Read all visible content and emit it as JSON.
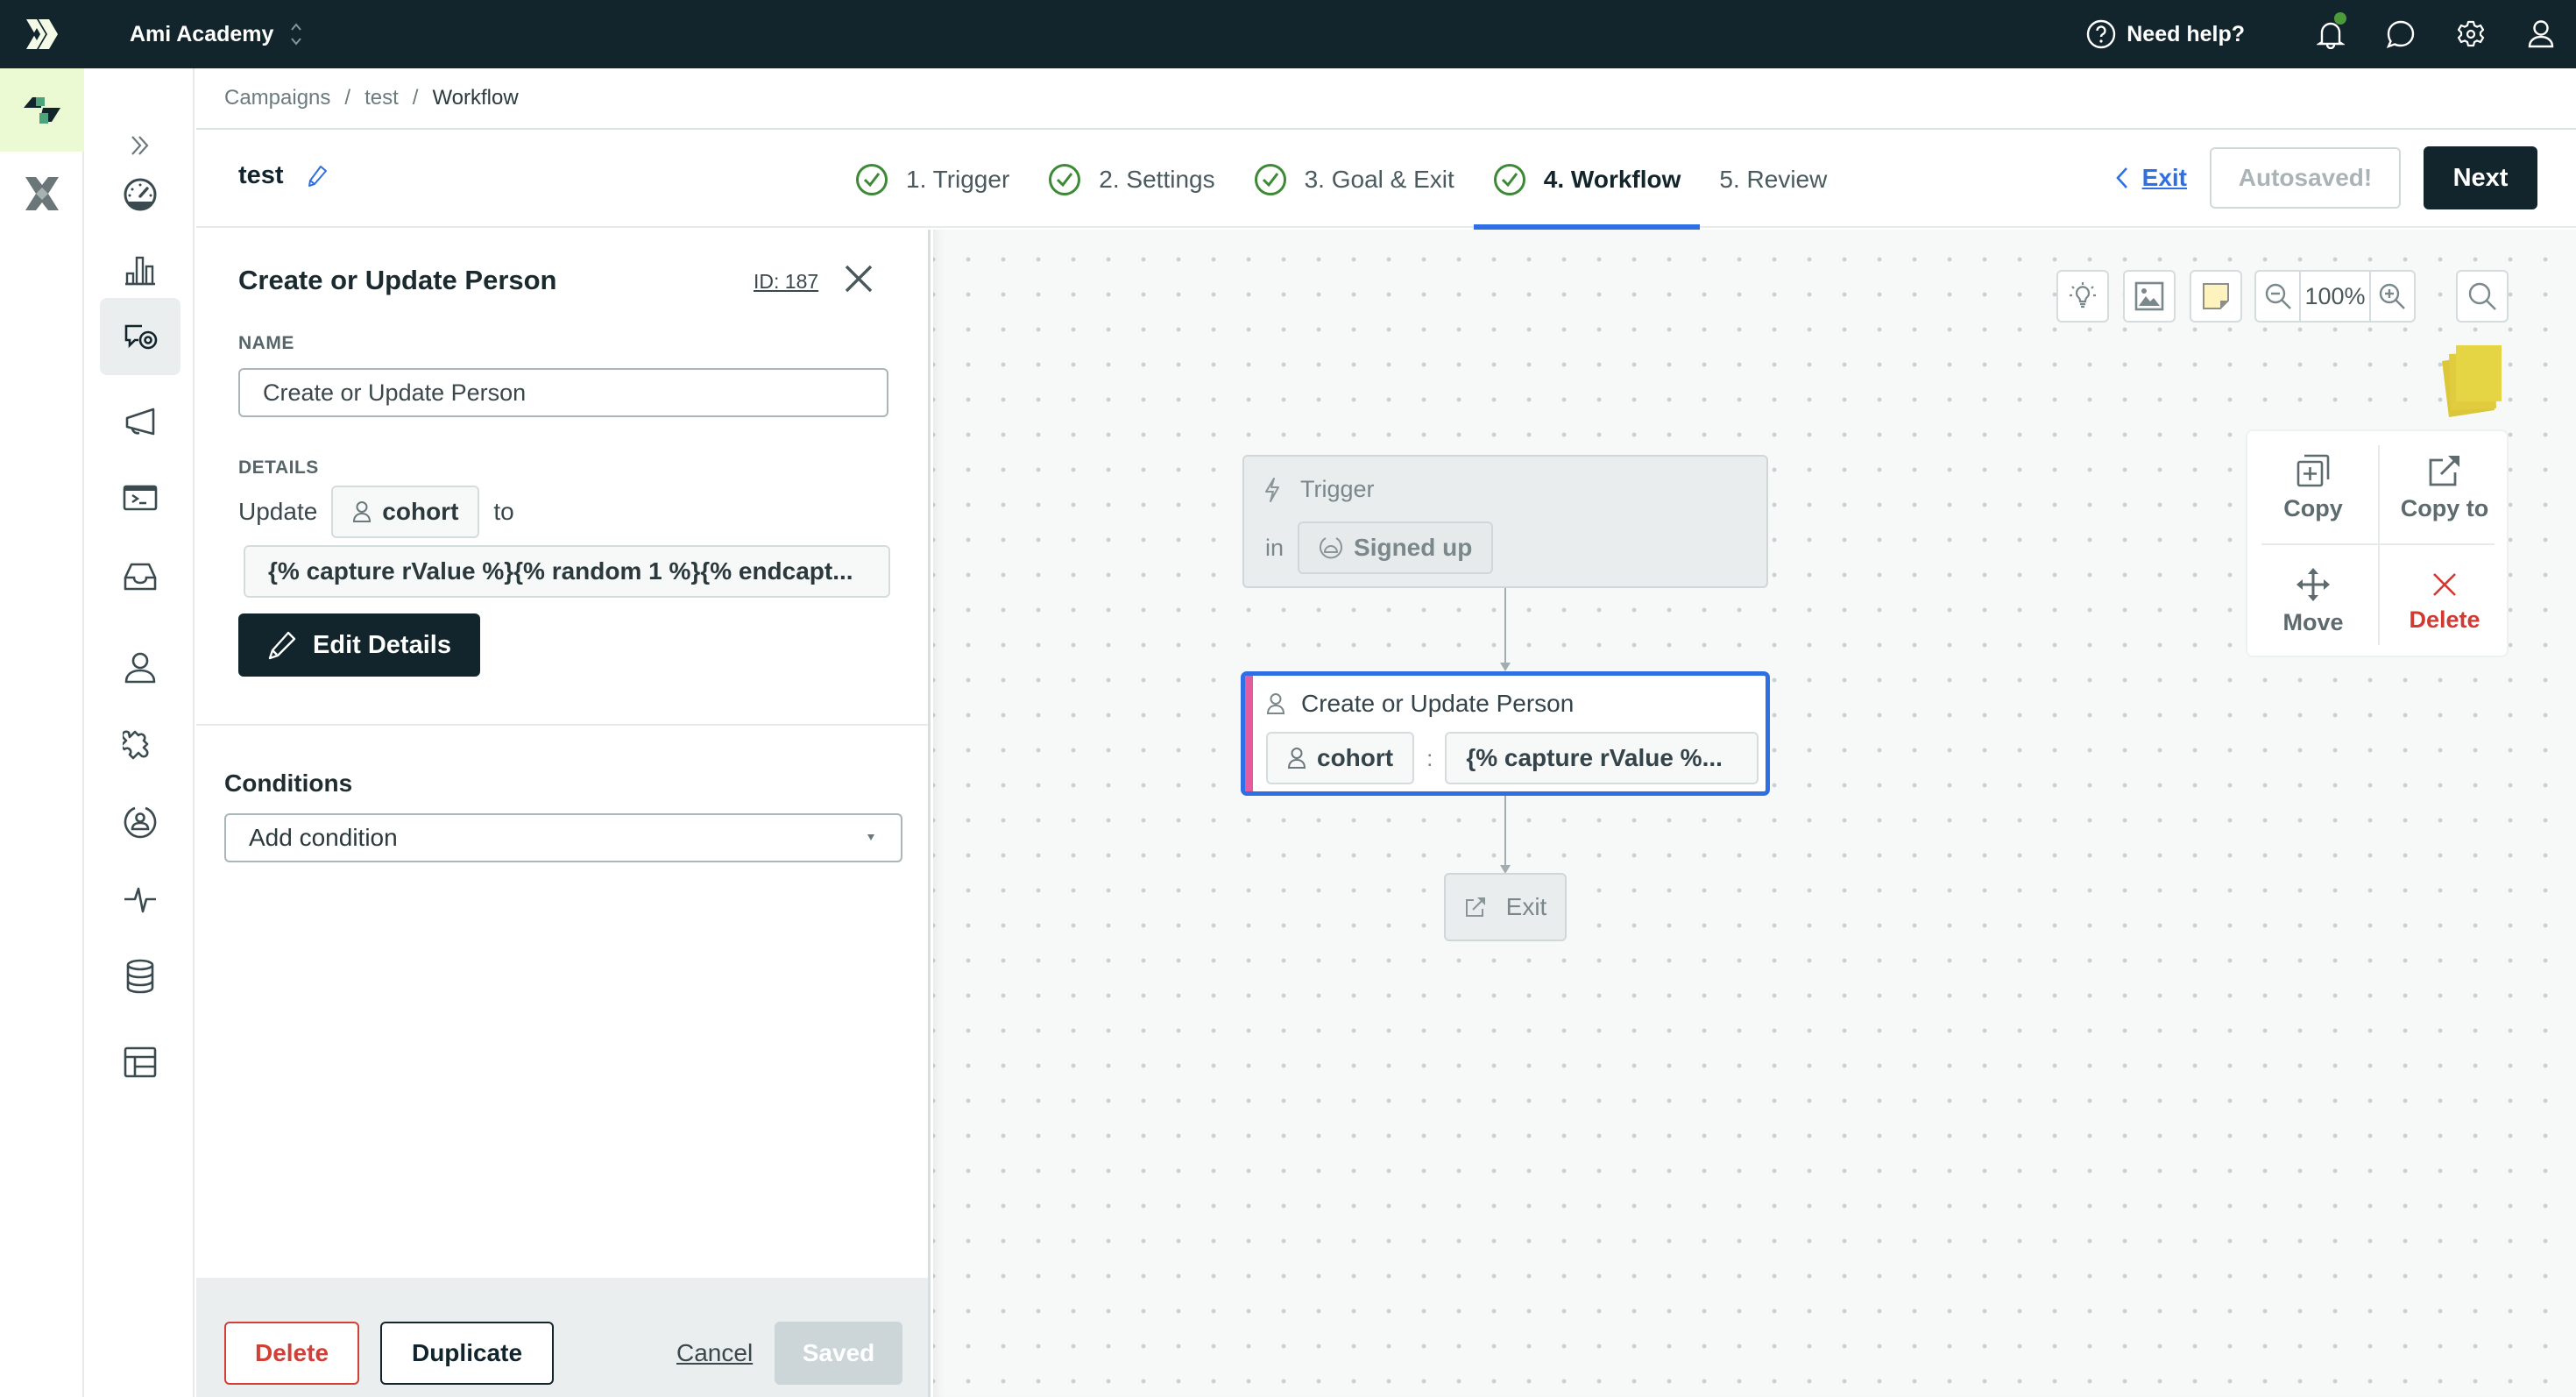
{
  "topbar": {
    "workspace": "Ami Academy",
    "help_label": "Need help?",
    "notification_dot_color": "#4c9b3a"
  },
  "breadcrumb": [
    "Campaigns",
    "test",
    "Workflow"
  ],
  "header": {
    "campaign_name": "test",
    "steps": [
      {
        "label": "1. Trigger",
        "done": true
      },
      {
        "label": "2. Settings",
        "done": true
      },
      {
        "label": "3. Goal & Exit",
        "done": true
      },
      {
        "label": "4. Workflow",
        "done": true,
        "active": true
      },
      {
        "label": "5. Review",
        "done": false
      }
    ],
    "exit_label": "Exit",
    "autosaved_label": "Autosaved!",
    "next_label": "Next"
  },
  "panel": {
    "title": "Create or Update Person",
    "id_label": "ID: 187",
    "name_label": "NAME",
    "name_value": "Create or Update Person",
    "details_label": "DETAILS",
    "update_word": "Update",
    "attribute": "cohort",
    "to_word": "to",
    "value": "{% capture rValue %}{% random 1 %}{% endcapt...",
    "edit_details_label": "Edit Details",
    "conditions_title": "Conditions",
    "conditions_select": "Add condition",
    "footer": {
      "delete_label": "Delete",
      "duplicate_label": "Duplicate",
      "cancel_label": "Cancel",
      "saved_label": "Saved"
    }
  },
  "canvas": {
    "zoom_level": "100%",
    "trigger_node": {
      "title": "Trigger",
      "in_word": "in",
      "segment": "Signed up"
    },
    "update_node": {
      "title": "Create or Update Person",
      "attribute": "cohort",
      "separator": ":",
      "value": "{% capture rValue %..."
    },
    "exit_node": {
      "label": "Exit"
    },
    "context_menu": {
      "copy": "Copy",
      "copy_to": "Copy to",
      "move": "Move",
      "delete": "Delete"
    }
  },
  "colors": {
    "accent_blue": "#2f6fe4",
    "dark": "#13252c",
    "success_green": "#3c8a35",
    "danger_red": "#d04037",
    "node_stripe_pink": "#e35c9f"
  }
}
